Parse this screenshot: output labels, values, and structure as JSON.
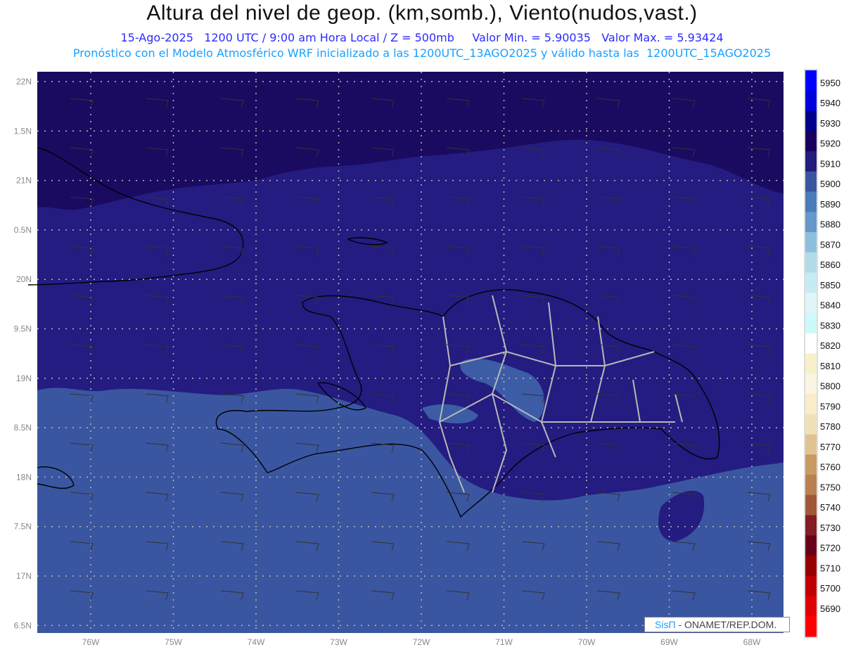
{
  "header": {
    "title": "Altura del nivel de geop. (km,somb.), Viento(nudos,vast.)",
    "subtitle": "15-Ago-2025   1200 UTC / 9:00 am Hora Local / Z = 500mb     Valor Min. = 5.90035   Valor Max. = 5.93424",
    "model_line": "Pronóstico con el Modelo Atmosférico WRF inicializado a las 1200UTC_13AGO2025 y válido hasta las  1200UTC_15AGO2025"
  },
  "axes": {
    "lat_labels": [
      "22N",
      "1.5N",
      "21N",
      "0.5N",
      "20N",
      "9.5N",
      "19N",
      "8.5N",
      "18N",
      "7.5N",
      "17N",
      "6.5N"
    ],
    "lon_labels": [
      "76W",
      "75W",
      "74W",
      "73W",
      "72W",
      "71W",
      "70W",
      "69W",
      "68W"
    ]
  },
  "colorbar": {
    "labels": [
      "5950",
      "5940",
      "5930",
      "5920",
      "5910",
      "5900",
      "5890",
      "5880",
      "5870",
      "5860",
      "5850",
      "5840",
      "5830",
      "5820",
      "5810",
      "5800",
      "5790",
      "5780",
      "5770",
      "5760",
      "5750",
      "5740",
      "5730",
      "5720",
      "5710",
      "5700",
      "5690"
    ],
    "colors": [
      "#0000ff",
      "#0000dc",
      "#00008c",
      "#180060",
      "#221c7c",
      "#3a55a0",
      "#4a7cb9",
      "#6498c8",
      "#8cbfdd",
      "#b0dcea",
      "#c4ecf2",
      "#dff5f8",
      "#ccf9f9",
      "#ffffff",
      "#f8f0c8",
      "#faf4e2",
      "#f8eccb",
      "#f0e2b8",
      "#e0c390",
      "#c89a64",
      "#b98150",
      "#a05838",
      "#841c26",
      "#6a0018",
      "#980000",
      "#c00000",
      "#e00000",
      "#ff0000"
    ]
  },
  "map_colors": {
    "high": "#1a0a60",
    "mid": "#241c80",
    "low": "#3a56a0",
    "light_patch": "#3c5ca6"
  },
  "credit": {
    "brand": "SisΠ",
    "text": " - ONAMET/REP.DOM."
  }
}
